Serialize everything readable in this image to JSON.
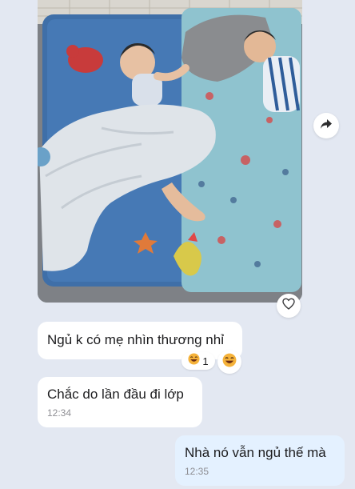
{
  "messages": [
    {
      "type": "image",
      "alt": "photo",
      "actions": {
        "share_icon": "share-forward-icon",
        "like_icon": "heart-outline-icon"
      }
    },
    {
      "type": "text",
      "text": "Ngủ k có mẹ nhìn thương nhỉ",
      "reaction": {
        "emoji_icon": "laughing-face-icon",
        "count": "1"
      }
    },
    {
      "type": "text",
      "text": "Chắc do lần đầu đi lớp",
      "time": "12:34"
    },
    {
      "type": "text",
      "text": "Nhà nó vẫn ngủ thế mà",
      "time": "12:35",
      "outgoing": true
    }
  ],
  "colors": {
    "background": "#e3e8f2",
    "incoming_bubble": "#ffffff",
    "outgoing_bubble": "#e4f1ff",
    "timestamp": "#8e8e93"
  }
}
